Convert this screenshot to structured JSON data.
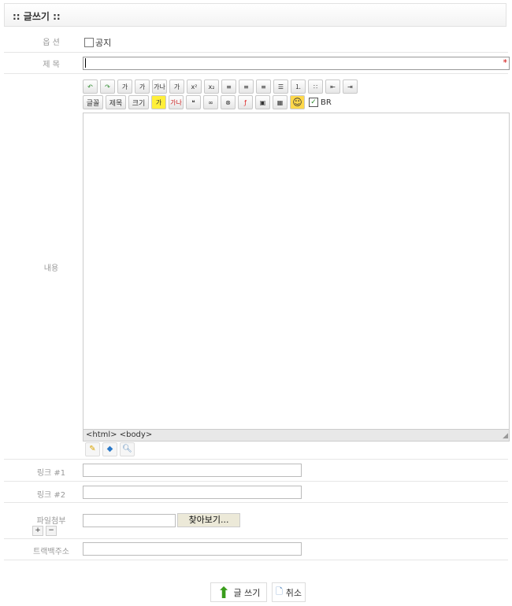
{
  "header": {
    "title": ":: 글쓰기 ::"
  },
  "option": {
    "label": "옵 션",
    "notice_label": "공지"
  },
  "subject": {
    "label": "제 목",
    "value": "",
    "required_mark": "*"
  },
  "content": {
    "label": "내용",
    "toolbar1": [
      {
        "icon": "undo-icon",
        "g": "↶"
      },
      {
        "icon": "redo-icon",
        "g": "↷"
      },
      {
        "icon": "bold-icon",
        "g": "가"
      },
      {
        "icon": "underline-icon",
        "g": "가"
      },
      {
        "icon": "strikethrough-icon",
        "g": "가나"
      },
      {
        "icon": "italic-icon",
        "g": "가"
      },
      {
        "icon": "superscript-icon",
        "g": "x²"
      },
      {
        "icon": "subscript-icon",
        "g": "x₂"
      },
      {
        "icon": "align-left-icon",
        "g": "≡"
      },
      {
        "icon": "align-center-icon",
        "g": "≡"
      },
      {
        "icon": "align-right-icon",
        "g": "≡"
      },
      {
        "icon": "align-justify-icon",
        "g": "☰"
      },
      {
        "icon": "ordered-list-icon",
        "g": "⒈"
      },
      {
        "icon": "unordered-list-icon",
        "g": "∷"
      },
      {
        "icon": "outdent-icon",
        "g": "⇤"
      },
      {
        "icon": "indent-icon",
        "g": "⇥"
      }
    ],
    "font_label": "글꼴",
    "heading_label": "제목",
    "size_label": "크기",
    "toolbar2": [
      {
        "icon": "highlight-icon",
        "g": "가"
      },
      {
        "icon": "font-color-icon",
        "g": "가나"
      },
      {
        "icon": "quote-icon",
        "g": "❝"
      },
      {
        "icon": "link-icon",
        "g": "∞"
      },
      {
        "icon": "unlink-icon",
        "g": "⊗"
      },
      {
        "icon": "flash-icon",
        "g": "ƒ"
      },
      {
        "icon": "image-icon",
        "g": "▣"
      },
      {
        "icon": "table-icon",
        "g": "▦"
      },
      {
        "icon": "emoticon-icon",
        "g": "☺"
      }
    ],
    "br_label": "BR",
    "status_path": "<html> <body>"
  },
  "link1": {
    "label": "링크 #1",
    "value": ""
  },
  "link2": {
    "label": "링크 #2",
    "value": ""
  },
  "file": {
    "label": "파일첨부",
    "add": "+",
    "remove": "−",
    "browse_label": "찾아보기..."
  },
  "trackback": {
    "label": "트랙백주소",
    "value": ""
  },
  "actions": {
    "submit_label": "글 쓰기",
    "cancel_label": "취소"
  }
}
